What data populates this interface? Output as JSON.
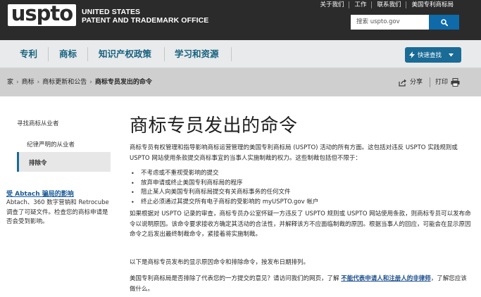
{
  "header": {
    "logo": "uspto",
    "agency_line1": "UNITED STATES",
    "agency_line2": "PATENT AND TRADEMARK OFFICE",
    "top_links": [
      "关于我们",
      "工作",
      "联系我们",
      "美国专利商标局"
    ],
    "search_placeholder": "搜索 uspto.gov"
  },
  "nav": {
    "items": [
      "专利",
      "商标",
      "知识产权政策",
      "学习和资源"
    ],
    "quick_search": "快速查找"
  },
  "breadcrumb": {
    "items": [
      "家",
      "商标",
      "商标更新和公告",
      "商标专员发出的命令"
    ],
    "share": "分享",
    "print": "打印"
  },
  "sidebar": {
    "item1": "寻找商标从业者",
    "item2": "纪律严明的从业者",
    "item3_active": "排除令",
    "promo_link": "受 Abtach 骗局的影响",
    "promo_text": "Abtach、360 数字营销和 Retrocube 调查了可疑文件。检查您的商标申请是否会受到影响。"
  },
  "main": {
    "title": "商标专员发出的命令",
    "para1": "商标专员有权管理和指导影响商标运营管理的美国专利商标局 (USPTO) 活动的所有方面。这包括对违反 USPTO 实践规则或 USPTO 网站使用条款提交商标事宜的当事人实施制裁的权力。这些制裁包括但不限于：",
    "bullets": [
      "不考虑或不重视受影响的提交",
      "放弃申请或终止美国专利商标局的程序",
      "阻止某人向美国专利商标局提交有关商标事务的任何文件",
      "终止必须通过其提交所有电子商标的受影响的 myUSPTO.gov 帐户"
    ],
    "para2": "如果根据对 USPTO 记录的审查，商标专员办公室怀疑一方违反了 USPTO 规则或 USPTO 网站使用条款，则商标专员可以发布命令以说明原因。该命令要求接收方确定其活动的合法性，并解释该方不应面临制裁的原因。根据当事人的回应，可能会在显示原因命令之后发出最终制裁命令，紧接着将实施制裁。",
    "para3": "以下是商标专员发布的显示原因命令和排除命令，按发布日期排列。",
    "para4_prefix": "美国专利商标局是否排除了代表您的一方提交的意见？请访问我们的网页，了解",
    "para4_link": "不能代表申请人和注册人的非律师",
    "para4_suffix": "，了解您应该做什么。"
  },
  "colors": {
    "header_bg": "#2b2b2b",
    "nav_bg": "#e8eaeb",
    "nav_text": "#16617f",
    "breadcrumb_bg": "#cfcfcf",
    "accent": "#1a6b96",
    "link": "#1a4e8c"
  }
}
